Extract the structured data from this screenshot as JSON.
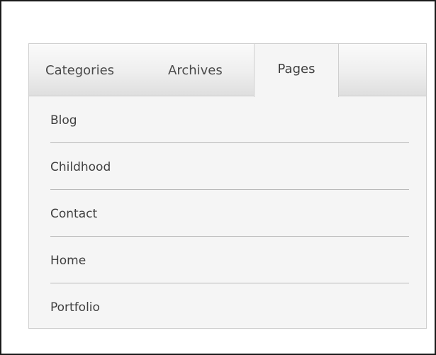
{
  "tabs": [
    {
      "label": "Categories",
      "active": false
    },
    {
      "label": "Archives",
      "active": false
    },
    {
      "label": "Pages",
      "active": true
    }
  ],
  "pages": [
    {
      "label": "Blog"
    },
    {
      "label": "Childhood"
    },
    {
      "label": "Contact"
    },
    {
      "label": "Home"
    },
    {
      "label": "Portfolio"
    }
  ],
  "colors": {
    "frame_border": "#1a1a1a",
    "widget_background": "#f5f5f5",
    "divider": "#b9b9b9",
    "text": "#404040"
  }
}
